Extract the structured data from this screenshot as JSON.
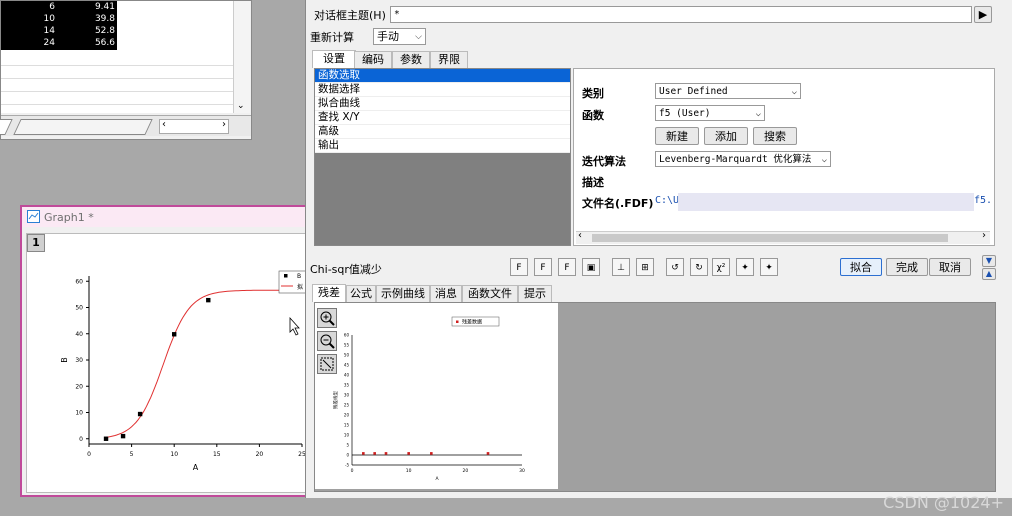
{
  "worksheet": {
    "rows": [
      {
        "a": "6",
        "b": "9.41"
      },
      {
        "a": "10",
        "b": "39.8"
      },
      {
        "a": "14",
        "b": "52.8"
      },
      {
        "a": "24",
        "b": "56.6"
      }
    ]
  },
  "graph": {
    "title": "Graph1 *",
    "layer": "1",
    "legend": [
      "B",
      "拟"
    ],
    "chart_data": {
      "type": "scatter",
      "xlabel": "A",
      "ylabel": "B",
      "xlim": [
        0,
        25
      ],
      "ylim": [
        -2,
        62
      ],
      "x_ticks": [
        "0",
        "5",
        "10",
        "15",
        "20",
        "25"
      ],
      "y_ticks": [
        "0",
        "10",
        "20",
        "30",
        "40",
        "50",
        "60"
      ],
      "series": [
        {
          "name": "B",
          "x": [
            2,
            4,
            6,
            10,
            14,
            24
          ],
          "y": [
            0,
            1,
            9.41,
            39.8,
            52.8,
            56.6
          ]
        }
      ],
      "fit_color": "#e03030",
      "point_color": "#000000"
    }
  },
  "dialog": {
    "theme_label": "对话框主题(H)",
    "theme_value": "*",
    "recalc_label": "重新计算",
    "recalc_value": "手动",
    "tabs": [
      "设置",
      "编码",
      "参数",
      "界限"
    ],
    "tree_items": [
      "函数选取",
      "数据选择",
      "拟合曲线",
      "查找 X/Y",
      "高级",
      "输出"
    ],
    "category_label": "类别",
    "category_value": "User Defined",
    "function_label": "函数",
    "function_value": "f5 (User)",
    "new_btn": "新建",
    "add_btn": "添加",
    "search_btn": "搜索",
    "iter_label": "迭代算法",
    "iter_value": "Levenberg-Marquardt 优化算法",
    "desc_label": "描述",
    "file_label": "文件名(.FDF)",
    "file_prefix": "C:\\U",
    "file_suffix": "f5.",
    "chi_label": "Chi-sqr值减少",
    "toolbar_icons": [
      "fit-one-iter-icon",
      "fit-until-converge-icon",
      "init-params-icon",
      "save-icon",
      "ellipse-icon",
      "reduced-icon",
      "undo-icon",
      "redo-icon",
      "chi-square-icon",
      "param-sync-icon",
      "param-fix-icon"
    ],
    "chi_sym": "χ²",
    "fit_btn": "拟合",
    "done_btn": "完成",
    "cancel_btn": "取消",
    "lower_tabs": [
      "残差",
      "公式",
      "示例曲线",
      "消息",
      "函数文件",
      "提示"
    ],
    "residual_legend": "残差数据",
    "residual_ylabel": "残差线型",
    "residual_xlabel": "A",
    "residual_x_ticks": [
      "0",
      "10",
      "20",
      "30"
    ],
    "residual_y_ticks": [
      "60",
      "55",
      "50",
      "45",
      "40",
      "35",
      "30",
      "25",
      "20",
      "15",
      "10",
      "5",
      "0",
      "-5"
    ],
    "residual_data": {
      "x": [
        2,
        4,
        6,
        10,
        14,
        24
      ],
      "y": [
        0,
        0,
        0,
        0,
        0,
        0
      ]
    }
  },
  "watermark": "CSDN @1024+"
}
